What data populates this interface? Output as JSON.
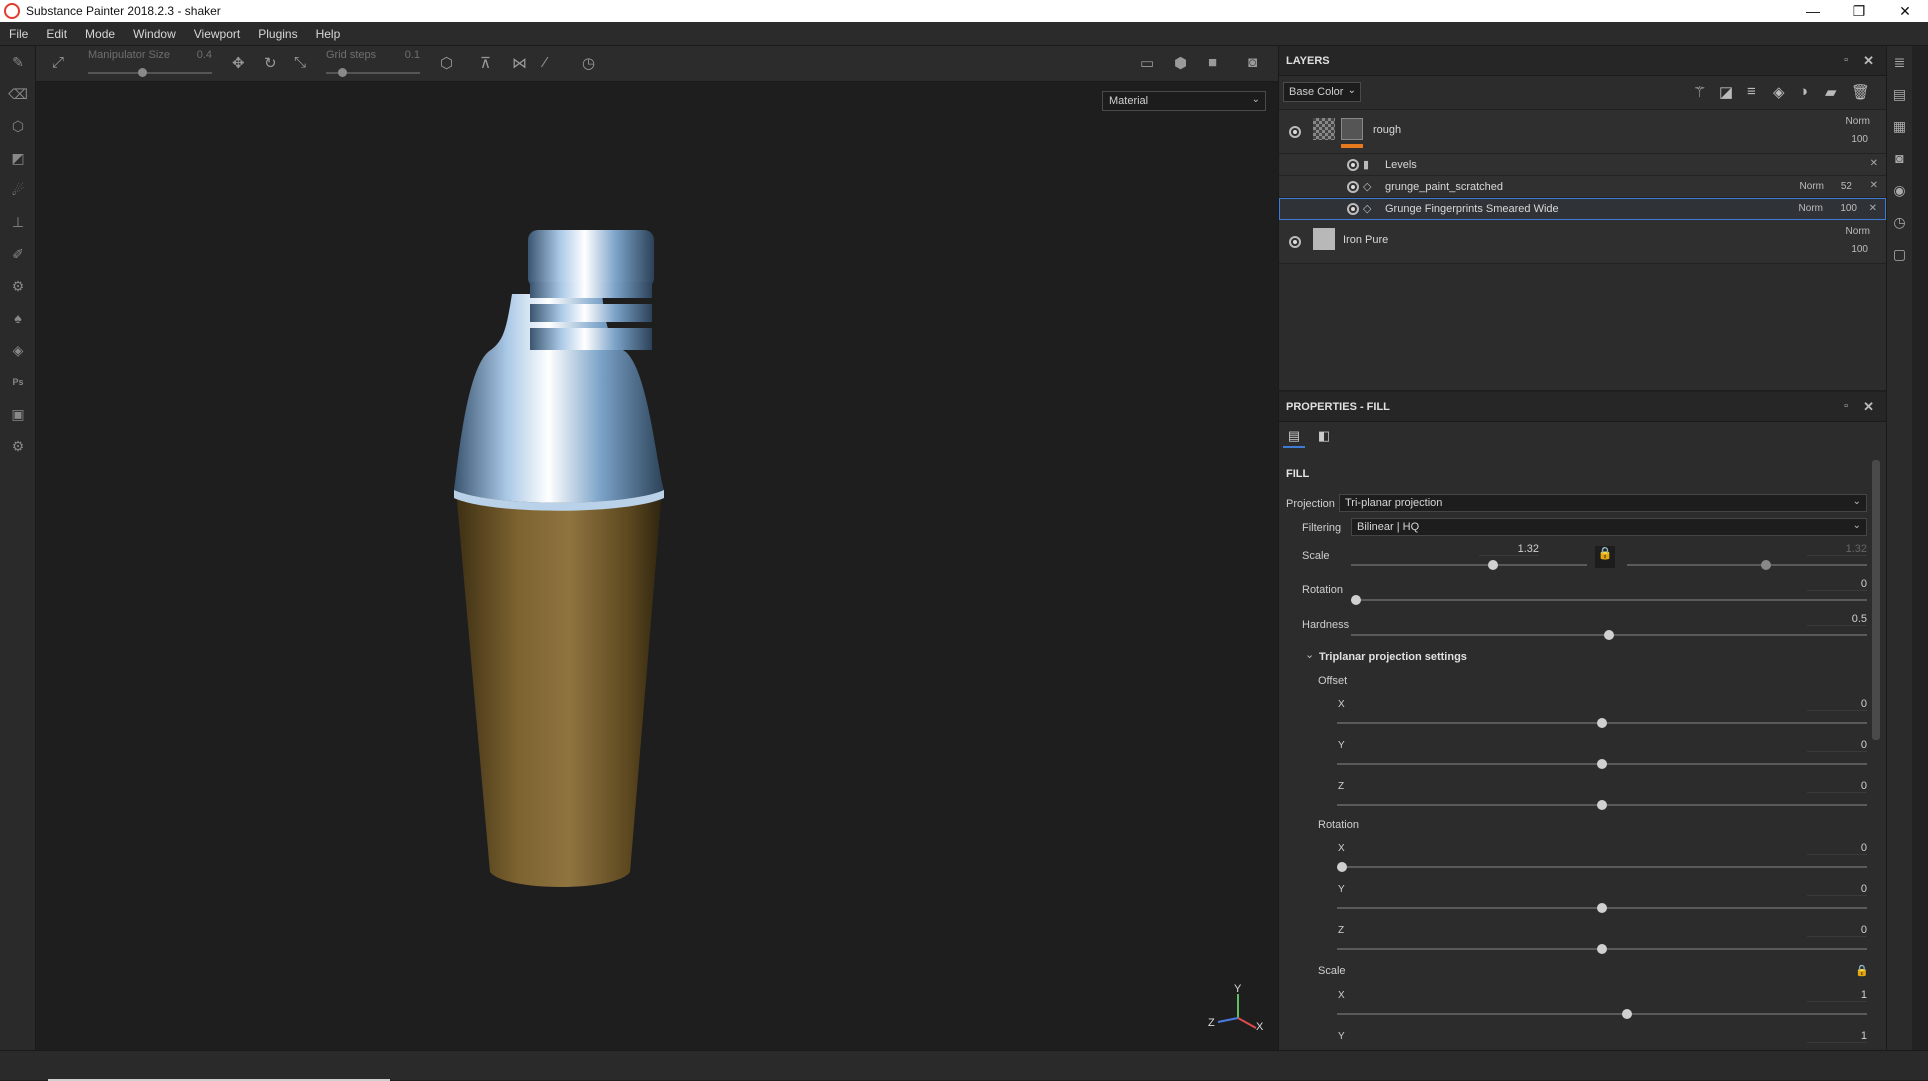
{
  "window": {
    "title": "Substance Painter 2018.2.3 - shaker",
    "minimize": "—",
    "maximize": "❐",
    "close": "✕"
  },
  "menu": [
    "File",
    "Edit",
    "Mode",
    "Window",
    "Viewport",
    "Plugins",
    "Help"
  ],
  "toolbar": {
    "manipulator_label": "Manipulator Size",
    "manipulator_value": "0.4",
    "grid_label": "Grid steps",
    "grid_value": "0.1"
  },
  "viewport": {
    "display_mode": "Material",
    "axis_x": "X",
    "axis_y": "Y",
    "axis_z": "Z"
  },
  "layers": {
    "title": "LAYERS",
    "channel": "Base Color",
    "items": [
      {
        "name": "rough",
        "blend": "Norm",
        "opacity": "100"
      },
      {
        "name": "Iron Pure",
        "blend": "Norm",
        "opacity": "100"
      }
    ],
    "effects": [
      {
        "name": "Levels"
      },
      {
        "name": "grunge_paint_scratched",
        "blend": "Norm",
        "opacity": "52"
      },
      {
        "name": "Grunge Fingerprints Smeared Wide",
        "blend": "Norm",
        "opacity": "100"
      }
    ]
  },
  "properties": {
    "title": "PROPERTIES - FILL",
    "section": "FILL",
    "projection_label": "Projection",
    "projection_value": "Tri-planar projection",
    "filtering_label": "Filtering",
    "filtering_value": "Bilinear | HQ",
    "scale_label": "Scale",
    "scale_value": "1.32",
    "scale_value2": "1.32",
    "rotation_label": "Rotation",
    "rotation_value": "0",
    "hardness_label": "Hardness",
    "hardness_value": "0.5",
    "triplanar_label": "Triplanar projection settings",
    "offset_label": "Offset",
    "rotation_group_label": "Rotation",
    "scale_group_label": "Scale",
    "x": "X",
    "y": "Y",
    "z": "Z",
    "offset": {
      "x": "0",
      "y": "0",
      "z": "0"
    },
    "rot": {
      "x": "0",
      "y": "0",
      "z": "0"
    },
    "scl": {
      "x": "1",
      "y": "1"
    }
  },
  "colors": {
    "accent": "#3d7bd4",
    "orange": "#e87a1d"
  }
}
